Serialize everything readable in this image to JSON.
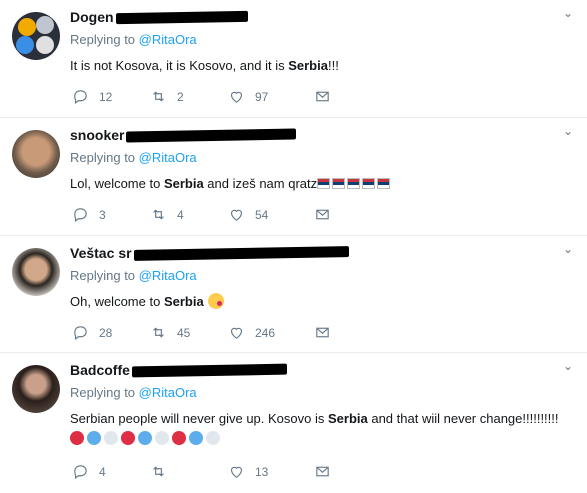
{
  "tweets": [
    {
      "name": "Dogen",
      "reply_prefix": "Replying to",
      "reply_handle": "@RitaOra",
      "text_parts": [
        "It is not Kosova, it is Kosovo, and it is ",
        "Serbia",
        "!!!"
      ],
      "replies": "12",
      "retweets": "2",
      "likes": "97"
    },
    {
      "name": "snooker",
      "reply_prefix": "Replying to",
      "reply_handle": "@RitaOra",
      "text_parts": [
        "Lol, welcome to ",
        "Serbia",
        " and izeš nam qratz"
      ],
      "flags": 5,
      "replies": "3",
      "retweets": "4",
      "likes": "54"
    },
    {
      "name": "Veštac",
      "name_suffix": "sr",
      "reply_prefix": "Replying to",
      "reply_handle": "@RitaOra",
      "text_parts": [
        "Oh, welcome to ",
        "Serbia"
      ],
      "emoji": "winking-kiss-face",
      "replies": "28",
      "retweets": "45",
      "likes": "246"
    },
    {
      "name": "Badcoffe",
      "reply_prefix": "Replying to",
      "reply_handle": "@RitaOra",
      "text_parts": [
        "Serbian people will never give up. Kosovo is ",
        "Serbia",
        " and that wiil never change!!!!!!!!!!"
      ],
      "circles": [
        "red",
        "blue",
        "white",
        "red",
        "blue",
        "white",
        "red",
        "blue",
        "white"
      ],
      "replies": "4",
      "retweets": "",
      "likes": "13"
    }
  ],
  "colors": {
    "link": "#1da1f2",
    "muted": "#657786",
    "text": "#14171a",
    "divider": "#e6ecf0"
  }
}
